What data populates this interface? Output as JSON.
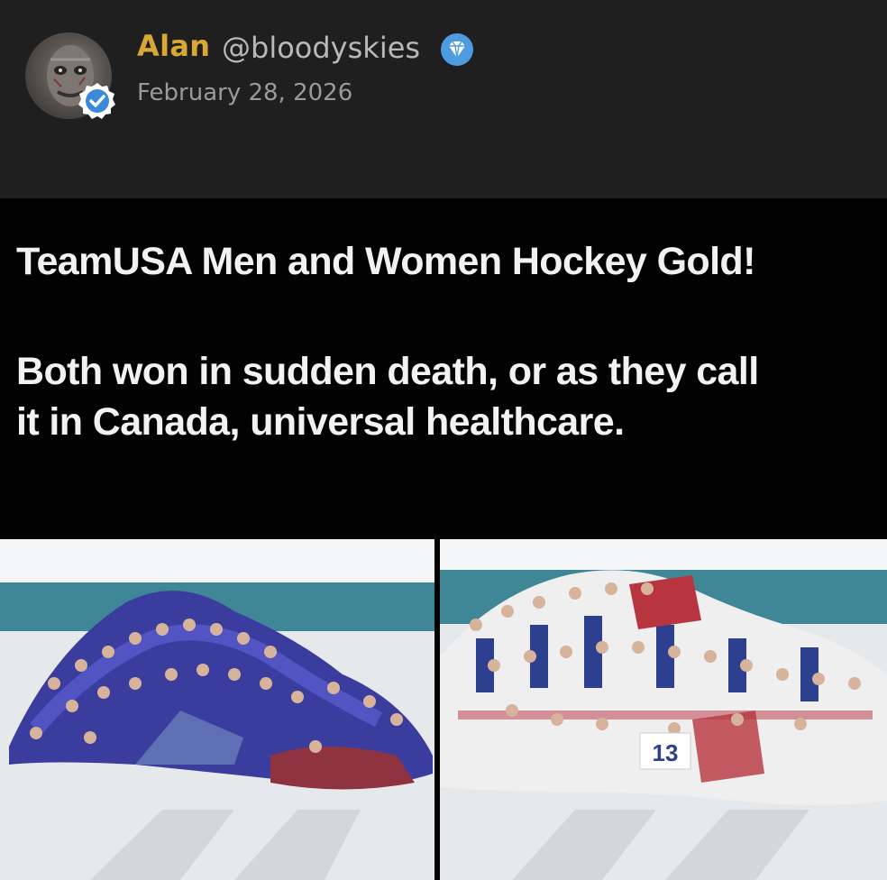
{
  "post": {
    "author": {
      "name": "Alan",
      "handle": "@bloodyskies",
      "avatar_icon": "avatar",
      "verified_icon": "verified-check-icon",
      "badge_icon": "diamond-icon"
    },
    "date": "February 28, 2026"
  },
  "meme": {
    "title": "TeamUSA Men and Women Hockey Gold!",
    "punchline_line1": "Both won in sudden death, or as they call",
    "punchline_line2": "it in Canada, universal healthcare.",
    "photos": [
      {
        "description_icon": "team-photo",
        "jersey_number": ""
      },
      {
        "description_icon": "team-photo",
        "jersey_number": "13"
      }
    ]
  },
  "colors": {
    "background": "#1e1e1f",
    "author_name": "#d9a735",
    "handle": "#b8b8b8",
    "date": "#9a9a9a",
    "meme_bg": "#020202",
    "meme_text": "#f2f2f2",
    "verified_blue": "#3b8ad9",
    "diamond": "#5aa3e0"
  }
}
